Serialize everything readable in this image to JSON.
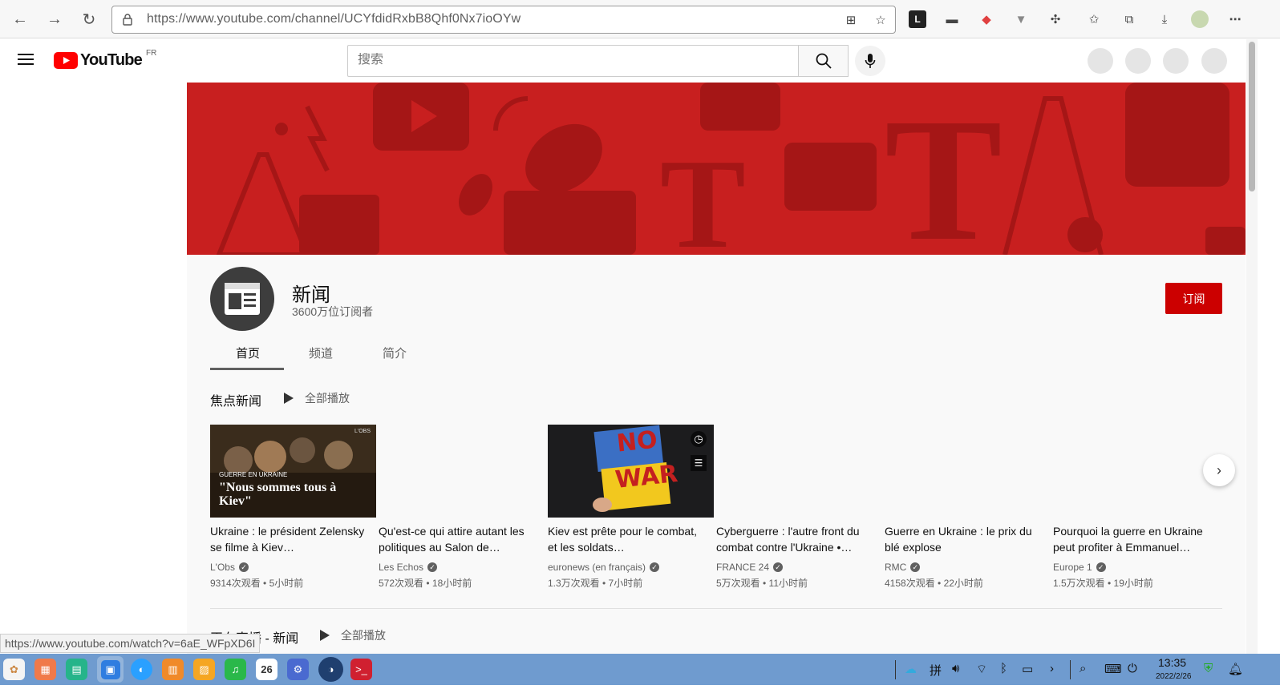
{
  "browser": {
    "url": "https://www.youtube.com/channel/UCYfdidRxbB8Qhf0Nx7ioOYw"
  },
  "youtube": {
    "logo_text": "YouTube",
    "region": "FR",
    "search_placeholder": "搜索"
  },
  "channel": {
    "name": "新闻",
    "subscribers": "3600万位订阅者",
    "subscribe_label": "订阅",
    "tabs": [
      {
        "label": "首页",
        "active": true
      },
      {
        "label": "频道",
        "active": false
      },
      {
        "label": "简介",
        "active": false
      }
    ]
  },
  "section": {
    "title": "焦点新闻",
    "play_all": "全部播放",
    "videos": [
      {
        "title": "Ukraine : le président Zelensky se filme à Kiev…",
        "channel": "L'Obs",
        "meta": "9314次观看 • 5小时前",
        "thumb_caption_small": "GUERRE EN UKRAINE",
        "thumb_caption": "\"Nous sommes tous à Kiev\"",
        "thumb_brand": "L'OBS"
      },
      {
        "title": "Qu'est-ce qui attire autant les politiques au Salon de…",
        "channel": "Les Echos",
        "meta": "572次观看 • 18小时前"
      },
      {
        "title": "Kiev est prête pour le combat, et les soldats…",
        "channel": "euronews (en français)",
        "meta": "1.3万次观看 • 7小时前",
        "thumb_sign_line1": "NO",
        "thumb_sign_line2": "WAR"
      },
      {
        "title": "Cyberguerre : l'autre front du combat contre l'Ukraine •…",
        "channel": "FRANCE 24",
        "meta": "5万次观看 • 11小时前"
      },
      {
        "title": "Guerre en Ukraine : le prix du blé explose",
        "channel": "RMC",
        "meta": "4158次观看 • 22小时前"
      },
      {
        "title": "Pourquoi la guerre en Ukraine peut profiter à Emmanuel…",
        "channel": "Europe 1",
        "meta": "1.5万次观看 • 19小时前"
      }
    ]
  },
  "section2": {
    "title": "正在直播 - 新闻",
    "play_all": "全部播放"
  },
  "status_url": "https://www.youtube.com/watch?v=6aE_WFpXD6I",
  "taskbar": {
    "time": "13:35",
    "date": "2022/2/26",
    "calendar_day": "26",
    "ime": "拼"
  },
  "colors": {
    "youtube_red": "#ff0000",
    "banner_red": "#c81f1f",
    "subscribe_red": "#cc0000",
    "taskbar_blue": "#6f9bcf"
  }
}
